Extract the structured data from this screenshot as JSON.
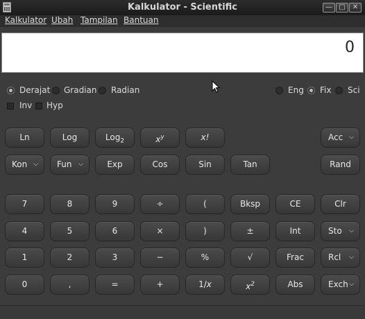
{
  "window": {
    "title": "Kalkulator - Scientific",
    "minimize": "—",
    "maximize": "□",
    "close": "✕"
  },
  "menu": [
    "Kalkulator",
    "Ubah",
    "Tampilan",
    "Bantuan"
  ],
  "display": {
    "value": "0"
  },
  "angle_modes": [
    {
      "label": "Derajat",
      "checked": true
    },
    {
      "label": "Gradian",
      "checked": false
    },
    {
      "label": "Radian",
      "checked": false
    }
  ],
  "notation_modes": [
    {
      "label": "Eng",
      "checked": false
    },
    {
      "label": "Fix",
      "checked": true
    },
    {
      "label": "Sci",
      "checked": false
    }
  ],
  "toggles": [
    {
      "label": "Inv",
      "checked": false
    },
    {
      "label": "Hyp",
      "checked": false
    }
  ],
  "buttons": {
    "ln": "Ln",
    "log": "Log",
    "log2_base": "Log",
    "log2_sub": "2",
    "xy_base": "x",
    "xy_sup": "y",
    "factorial": "x!",
    "acc": "Acc",
    "kon": "Kon",
    "fun": "Fun",
    "exp": "Exp",
    "cos": "Cos",
    "sin": "Sin",
    "tan": "Tan",
    "rand": "Rand",
    "d7": "7",
    "d8": "8",
    "d9": "9",
    "divide": "÷",
    "lparen": "(",
    "bksp": "Bksp",
    "ce": "CE",
    "clr": "Clr",
    "d4": "4",
    "d5": "5",
    "d6": "6",
    "multiply": "×",
    "rparen": ")",
    "plusminus": "±",
    "int": "Int",
    "sto": "Sto",
    "d1": "1",
    "d2": "2",
    "d3": "3",
    "minus": "−",
    "percent": "%",
    "sqrt": "√",
    "frac": "Frac",
    "rcl": "Rcl",
    "d0": "0",
    "comma": ",",
    "equals": "=",
    "plus": "+",
    "recip_1": "1/",
    "recip_x": "x",
    "x2_base": "x",
    "x2_sup": "2",
    "abs": "Abs",
    "exch": "Exch",
    "dropdown_arrow": "⌵"
  },
  "colors": {
    "display_bg": "#ffffff",
    "window_bg": "#3c3c3c",
    "button_bg": "#444444"
  }
}
